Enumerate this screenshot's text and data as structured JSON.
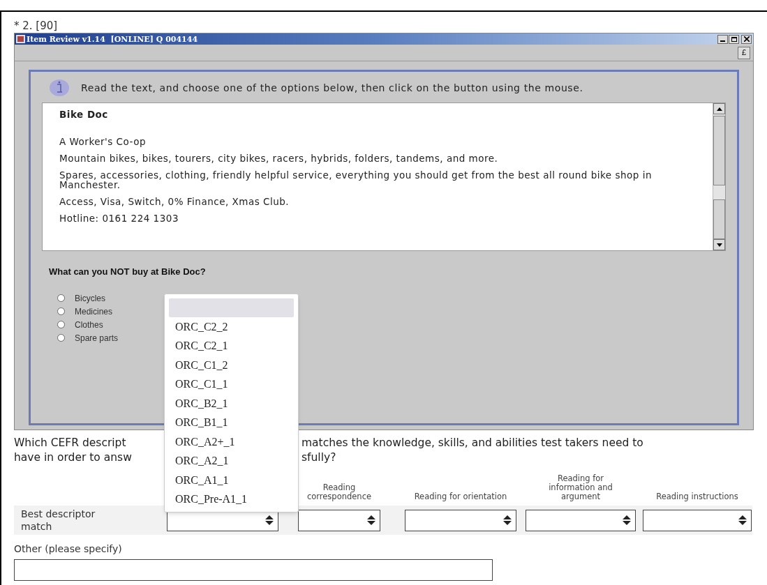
{
  "question_label": "* 2. [90]",
  "window": {
    "title": "Item Review v1.14  [ONLINE] Q 004144",
    "toolbar_button": "£",
    "instruction": "Read the text, and choose one of the options below, then click on the button using the mouse.",
    "passage": {
      "title": "Bike Doc",
      "paragraphs": [
        "A Worker's Co-op",
        "Mountain bikes, bikes, tourers, city bikes, racers, hybrids, folders, tandems, and more.",
        "Spares, accessories, clothing, friendly helpful service, everything you should get from the best all round bike shop in Manchester.",
        "Access, Visa, Switch, 0% Finance, Xmas Club.",
        "Hotline: 0161 224 1303"
      ]
    },
    "question": "What can you NOT buy at Bike Doc?",
    "options": [
      {
        "label": "Bicycles",
        "selected": false
      },
      {
        "label": "Medicines",
        "selected": false
      },
      {
        "label": "Clothes",
        "selected": false
      },
      {
        "label": "Spare parts",
        "selected": false
      }
    ]
  },
  "cefr_question": {
    "lines": [
      [
        "Which CEFR descript",
        "matches the knowledge, skills, and abilities test takers need to"
      ],
      [
        "have in order to answ",
        "sfully?"
      ]
    ]
  },
  "table": {
    "row_label": "Best descriptor match",
    "columns": [
      {
        "kind": "select"
      },
      {
        "kind": "select",
        "header": "Reading correspondence"
      },
      {
        "kind": "select",
        "header": "Reading for orientation"
      },
      {
        "kind": "select",
        "header": "Reading for information and argument"
      },
      {
        "kind": "select",
        "header": "Reading instructions"
      }
    ]
  },
  "dropdown": {
    "options": [
      {
        "kind": "blank",
        "selected": true
      },
      {
        "kind": "option",
        "label": "ORC_C2_2",
        "selected": false
      },
      {
        "kind": "option",
        "label": "ORC_C2_1",
        "selected": false
      },
      {
        "kind": "option",
        "label": "ORC_C1_2",
        "selected": false
      },
      {
        "kind": "option",
        "label": "ORC_C1_1",
        "selected": false
      },
      {
        "kind": "option",
        "label": "ORC_B2_1",
        "selected": false
      },
      {
        "kind": "option",
        "label": "ORC_B1_1",
        "selected": false
      },
      {
        "kind": "option",
        "label": "ORC_A2+_1",
        "selected": false
      },
      {
        "kind": "option",
        "label": "ORC_A2_1",
        "selected": false
      },
      {
        "kind": "option",
        "label": "ORC_A1_1",
        "selected": false
      },
      {
        "kind": "option",
        "label": "ORC_Pre-A1_1",
        "selected": false
      }
    ]
  },
  "other": {
    "label": "Other (please specify)"
  }
}
